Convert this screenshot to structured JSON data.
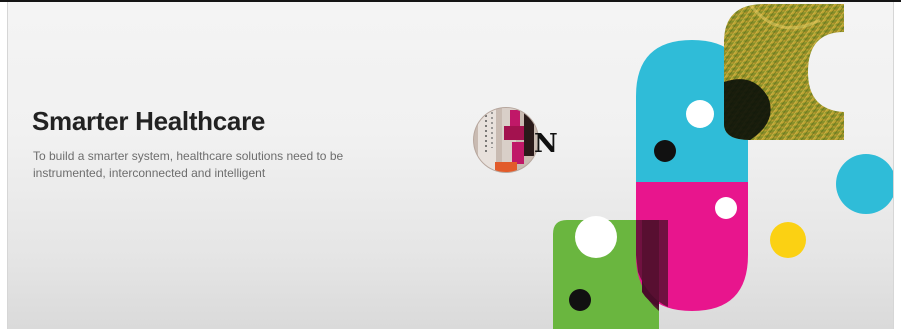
{
  "banner": {
    "headline": "Smarter Healthcare",
    "subtext_line1": "To build a smarter system, healthcare solutions need to be",
    "subtext_line2": "instrumented, interconnected and intelligent"
  },
  "colors": {
    "cyan": "#2fbcd8",
    "magenta": "#e8158d",
    "green": "#6ab63f",
    "yellow": "#fbd113",
    "dark_overlap": "#4a0c2a",
    "headline_text": "#222222",
    "body_text": "#6d6d6d"
  },
  "artwork": {
    "badge_photo": "medical-sample-tube-photo",
    "leaf_photo": "plant-leaf-macro-photo",
    "badge_letter": "N"
  }
}
